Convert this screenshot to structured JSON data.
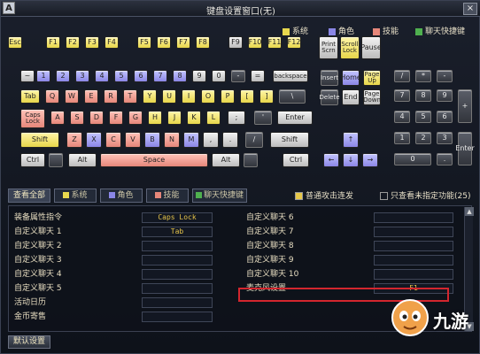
{
  "window": {
    "title": "键盘设置窗口(无)",
    "corner_label": "A",
    "close_glyph": "×"
  },
  "legend": [
    {
      "label": "系统",
      "color": "#e8d84e"
    },
    {
      "label": "角色",
      "color": "#8a86e6"
    },
    {
      "label": "技能",
      "color": "#e6877a"
    },
    {
      "label": "聊天快捷键",
      "color": "#4fb04f"
    }
  ],
  "keys": [
    {
      "label": "Esc",
      "c": "k-yellow"
    },
    {
      "label": "F1",
      "c": "k-yellow"
    },
    {
      "label": "F2",
      "c": "k-yellow"
    },
    {
      "label": "F3",
      "c": "k-yellow"
    },
    {
      "label": "F4",
      "c": "k-yellow"
    },
    {
      "label": "F5",
      "c": "k-yellow"
    },
    {
      "label": "F6",
      "c": "k-yellow"
    },
    {
      "label": "F7",
      "c": "k-yellow"
    },
    {
      "label": "F8",
      "c": "k-yellow"
    },
    {
      "label": "F9",
      "c": "k-gray"
    },
    {
      "label": "F10",
      "c": "k-yellow"
    },
    {
      "label": "F11",
      "c": "k-yellow"
    },
    {
      "label": "F12",
      "c": "k-yellow"
    },
    {
      "label": "Print Scrn",
      "c": "k-gray"
    },
    {
      "label": "Scroll Lock",
      "c": "k-yellow"
    },
    {
      "label": "Pause",
      "c": "k-gray"
    },
    {
      "label": "~",
      "c": "k-gray"
    },
    {
      "label": "1",
      "c": "k-blue"
    },
    {
      "label": "2",
      "c": "k-blue"
    },
    {
      "label": "3",
      "c": "k-blue"
    },
    {
      "label": "4",
      "c": "k-blue"
    },
    {
      "label": "5",
      "c": "k-blue"
    },
    {
      "label": "6",
      "c": "k-blue"
    },
    {
      "label": "7",
      "c": "k-blue"
    },
    {
      "label": "8",
      "c": "k-blue"
    },
    {
      "label": "9",
      "c": "k-gray"
    },
    {
      "label": "0",
      "c": "k-gray"
    },
    {
      "label": "-",
      "c": "k-dark"
    },
    {
      "label": "=",
      "c": "k-gray"
    },
    {
      "label": "backspace",
      "c": "k-gray"
    },
    {
      "label": "Insert",
      "c": "k-dark"
    },
    {
      "label": "Home",
      "c": "k-blue"
    },
    {
      "label": "Page Up",
      "c": "k-yellow"
    },
    {
      "label": "/",
      "c": "k-dark"
    },
    {
      "label": "*",
      "c": "k-dark"
    },
    {
      "label": "-",
      "c": "k-dark"
    },
    {
      "label": "Tab",
      "c": "k-yellow"
    },
    {
      "label": "Q",
      "c": "k-pink"
    },
    {
      "label": "W",
      "c": "k-pink"
    },
    {
      "label": "E",
      "c": "k-pink"
    },
    {
      "label": "R",
      "c": "k-pink"
    },
    {
      "label": "T",
      "c": "k-pink"
    },
    {
      "label": "Y",
      "c": "k-yellow"
    },
    {
      "label": "U",
      "c": "k-yellow"
    },
    {
      "label": "I",
      "c": "k-yellow"
    },
    {
      "label": "O",
      "c": "k-yellow"
    },
    {
      "label": "P",
      "c": "k-yellow"
    },
    {
      "label": "[",
      "c": "k-yellow"
    },
    {
      "label": "]",
      "c": "k-yellow"
    },
    {
      "label": "\\",
      "c": "k-dark"
    },
    {
      "label": "Delete",
      "c": "k-dark"
    },
    {
      "label": "End",
      "c": "k-gray"
    },
    {
      "label": "Page Down",
      "c": "k-gray"
    },
    {
      "label": "7",
      "c": "k-dark"
    },
    {
      "label": "8",
      "c": "k-dark"
    },
    {
      "label": "9",
      "c": "k-dark"
    },
    {
      "label": "+",
      "c": "k-dark"
    },
    {
      "label": "Caps Lock",
      "c": "k-pink"
    },
    {
      "label": "A",
      "c": "k-pink"
    },
    {
      "label": "S",
      "c": "k-pink"
    },
    {
      "label": "D",
      "c": "k-pink"
    },
    {
      "label": "F",
      "c": "k-pink"
    },
    {
      "label": "G",
      "c": "k-pink"
    },
    {
      "label": "H",
      "c": "k-yellow"
    },
    {
      "label": "J",
      "c": "k-yellow"
    },
    {
      "label": "K",
      "c": "k-yellow"
    },
    {
      "label": "L",
      "c": "k-yellow"
    },
    {
      "label": ";",
      "c": "k-gray"
    },
    {
      "label": "'",
      "c": "k-dark"
    },
    {
      "label": "Enter",
      "c": "k-gray"
    },
    {
      "label": "4",
      "c": "k-dark"
    },
    {
      "label": "5",
      "c": "k-dark"
    },
    {
      "label": "6",
      "c": "k-dark"
    },
    {
      "label": "Shift",
      "c": "k-yellow"
    },
    {
      "label": "Z",
      "c": "k-pink"
    },
    {
      "label": "X",
      "c": "k-blue"
    },
    {
      "label": "C",
      "c": "k-pink"
    },
    {
      "label": "V",
      "c": "k-pink"
    },
    {
      "label": "B",
      "c": "k-blue"
    },
    {
      "label": "N",
      "c": "k-pink"
    },
    {
      "label": "M",
      "c": "k-blue"
    },
    {
      "label": ",",
      "c": "k-gray"
    },
    {
      "label": ".",
      "c": "k-gray"
    },
    {
      "label": "/",
      "c": "k-dark"
    },
    {
      "label": "Shift",
      "c": "k-gray"
    },
    {
      "label": "↑",
      "c": "k-blue"
    },
    {
      "label": "1",
      "c": "k-dark"
    },
    {
      "label": "2",
      "c": "k-dark"
    },
    {
      "label": "3",
      "c": "k-dark"
    },
    {
      "label": "Enter",
      "c": "k-dark"
    },
    {
      "label": "Ctrl",
      "c": "k-gray"
    },
    {
      "label": "",
      "c": "k-dark"
    },
    {
      "label": "Alt",
      "c": "k-gray"
    },
    {
      "label": "Space",
      "c": "k-pink"
    },
    {
      "label": "Alt",
      "c": "k-gray"
    },
    {
      "label": "",
      "c": "k-dark"
    },
    {
      "label": "Ctrl",
      "c": "k-gray"
    },
    {
      "label": "←",
      "c": "k-blue"
    },
    {
      "label": "↓",
      "c": "k-blue"
    },
    {
      "label": "→",
      "c": "k-blue"
    },
    {
      "label": "0",
      "c": "k-dark"
    },
    {
      "label": ".",
      "c": "k-dark"
    }
  ],
  "tabs": [
    {
      "label": "查看全部",
      "color": ""
    },
    {
      "label": "系统",
      "color": "#e8d84e"
    },
    {
      "label": "角色",
      "color": "#8a86e6"
    },
    {
      "label": "技能",
      "color": "#e6877a"
    },
    {
      "label": "聊天快捷键",
      "color": "#4fb04f"
    }
  ],
  "options": {
    "normal_attack": "普通攻击连发",
    "show_unassigned": "只查看未指定功能(25)"
  },
  "left_rows": [
    {
      "label": "装备属性指令",
      "value": "Caps Lock"
    },
    {
      "label": "自定义聊天 1",
      "value": "Tab"
    },
    {
      "label": "自定义聊天 2",
      "value": ""
    },
    {
      "label": "自定义聊天 3",
      "value": ""
    },
    {
      "label": "自定义聊天 4",
      "value": ""
    },
    {
      "label": "自定义聊天 5",
      "value": ""
    },
    {
      "label": "活动日历",
      "value": ""
    },
    {
      "label": "金币寄售",
      "value": ""
    }
  ],
  "right_rows": [
    {
      "label": "自定义聊天 6",
      "value": ""
    },
    {
      "label": "自定义聊天 7",
      "value": ""
    },
    {
      "label": "自定义聊天 8",
      "value": ""
    },
    {
      "label": "自定义聊天 9",
      "value": ""
    },
    {
      "label": "自定义聊天 10",
      "value": ""
    },
    {
      "label": "麦克风设置",
      "value": "F1"
    }
  ],
  "buttons": {
    "default_settings": "默认设置"
  },
  "watermark": {
    "text": "九游"
  }
}
